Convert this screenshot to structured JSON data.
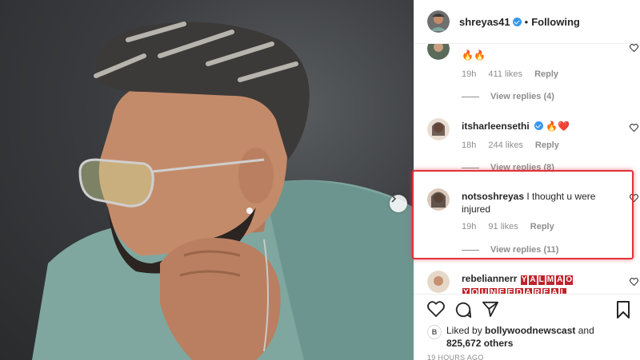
{
  "post": {
    "username": "shreyas41",
    "follow_status": "Following",
    "dot": "•"
  },
  "comments": [
    {
      "username": "",
      "text": "🔥🔥",
      "time": "19h",
      "likes": "411 likes",
      "reply": "Reply",
      "view_replies": "View replies (4)"
    },
    {
      "username": "itsharleensethi",
      "text": "🔥❤️",
      "time": "18h",
      "likes": "244 likes",
      "reply": "Reply",
      "view_replies": "View replies (8)"
    },
    {
      "username": "notsoshreyas",
      "text": "I thought u were injured",
      "time": "19h",
      "likes": "91 likes",
      "reply": "Reply",
      "view_replies": "View replies (11)"
    },
    {
      "username": "rebeliannerr",
      "text_boxes": [
        "Y",
        "A",
        "L",
        "M",
        "A",
        "O"
      ],
      "text_line2_boxes": [
        "Y",
        "O",
        "U",
        "N",
        "E",
        "E",
        "D",
        "A",
        "R",
        "E",
        "A",
        "L"
      ]
    }
  ],
  "likes_summary": {
    "prefix": "Liked by",
    "user": "bollywoodnewscast",
    "and": "and",
    "others": "825,672 others",
    "mini_avatar_letter": "B"
  },
  "timestamp": "19 HOURS AGO",
  "icons": [
    "heart-icon",
    "comment-icon",
    "share-icon",
    "bookmark-icon"
  ],
  "colors": {
    "accent": "#3897f0",
    "highlight": "#e0323a",
    "muted": "#8e8e8e"
  }
}
